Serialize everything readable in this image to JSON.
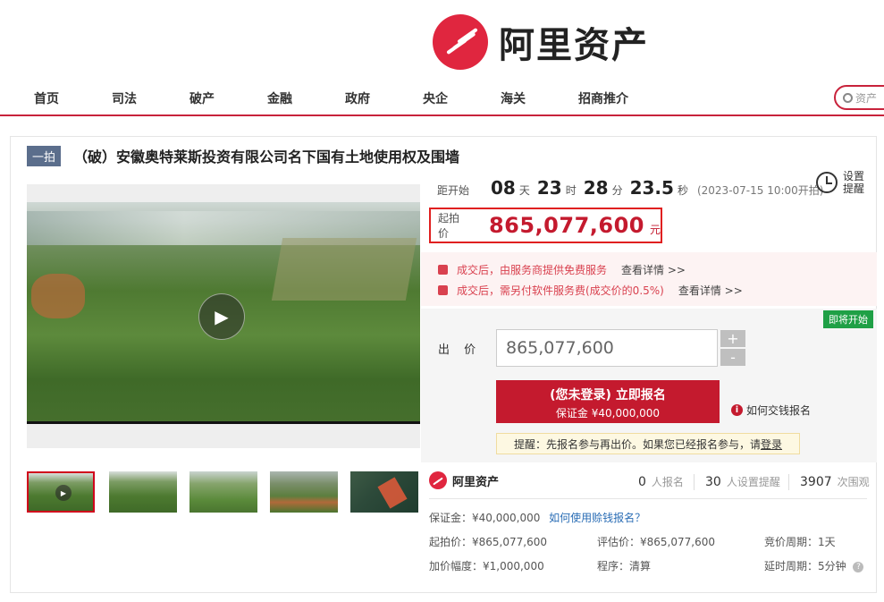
{
  "brand": {
    "name": "阿里资产",
    "accent": "#c8223b"
  },
  "nav": {
    "items": [
      "首页",
      "司法",
      "破产",
      "金融",
      "政府",
      "央企",
      "海关",
      "招商推介"
    ],
    "search_placeholder": "资产"
  },
  "listing": {
    "tag": "一拍",
    "title": "（破）安徽奥特莱斯投资有限公司名下国有土地使用权及围墙"
  },
  "countdown": {
    "label": "距开始",
    "days": "08",
    "days_unit": "天",
    "hours": "23",
    "hours_unit": "时",
    "minutes": "28",
    "minutes_unit": "分",
    "seconds": "23.5",
    "seconds_unit": "秒",
    "start_time": "(2023-07-15 10:00开拍)"
  },
  "remind": {
    "label": "设置提醒",
    "icon": "clock-icon"
  },
  "start_price": {
    "label": "起拍价",
    "value": "865,077,600",
    "unit": "元"
  },
  "services": [
    {
      "text": "成交后，由服务商提供免费服务",
      "link": "查看详情 >>"
    },
    {
      "text": "成交后，需另付软件服务费(成交价的0.5%)",
      "link": "查看详情 >>"
    }
  ],
  "bid": {
    "status_badge": "即将开始",
    "label": "出 价",
    "input_value": "865,077,600",
    "plus": "+",
    "minus": "-",
    "signup_main": "(您未登录) 立即报名",
    "signup_sub": "保证金 ¥40,000,000",
    "howto": "如何交钱报名",
    "hint_text": "提醒：先报名参与再出价。如果您已经报名参与，请",
    "hint_link": "登录"
  },
  "stats": {
    "signups": "0",
    "signups_label": "人报名",
    "reminders": "30",
    "reminders_label": "人设置提醒",
    "views": "3907",
    "views_label": "次围观"
  },
  "details": {
    "deposit": "保证金：¥40,000,000",
    "deposit_link": "如何使用赊钱报名？",
    "start_price": "起拍价：¥865,077,600",
    "assessed": "评估价：¥865,077,600",
    "cycle": "竞价周期：1天",
    "increment": "加价幅度：¥1,000,000",
    "procedure": "程序：清算",
    "delay": "延时周期：5分钟"
  }
}
